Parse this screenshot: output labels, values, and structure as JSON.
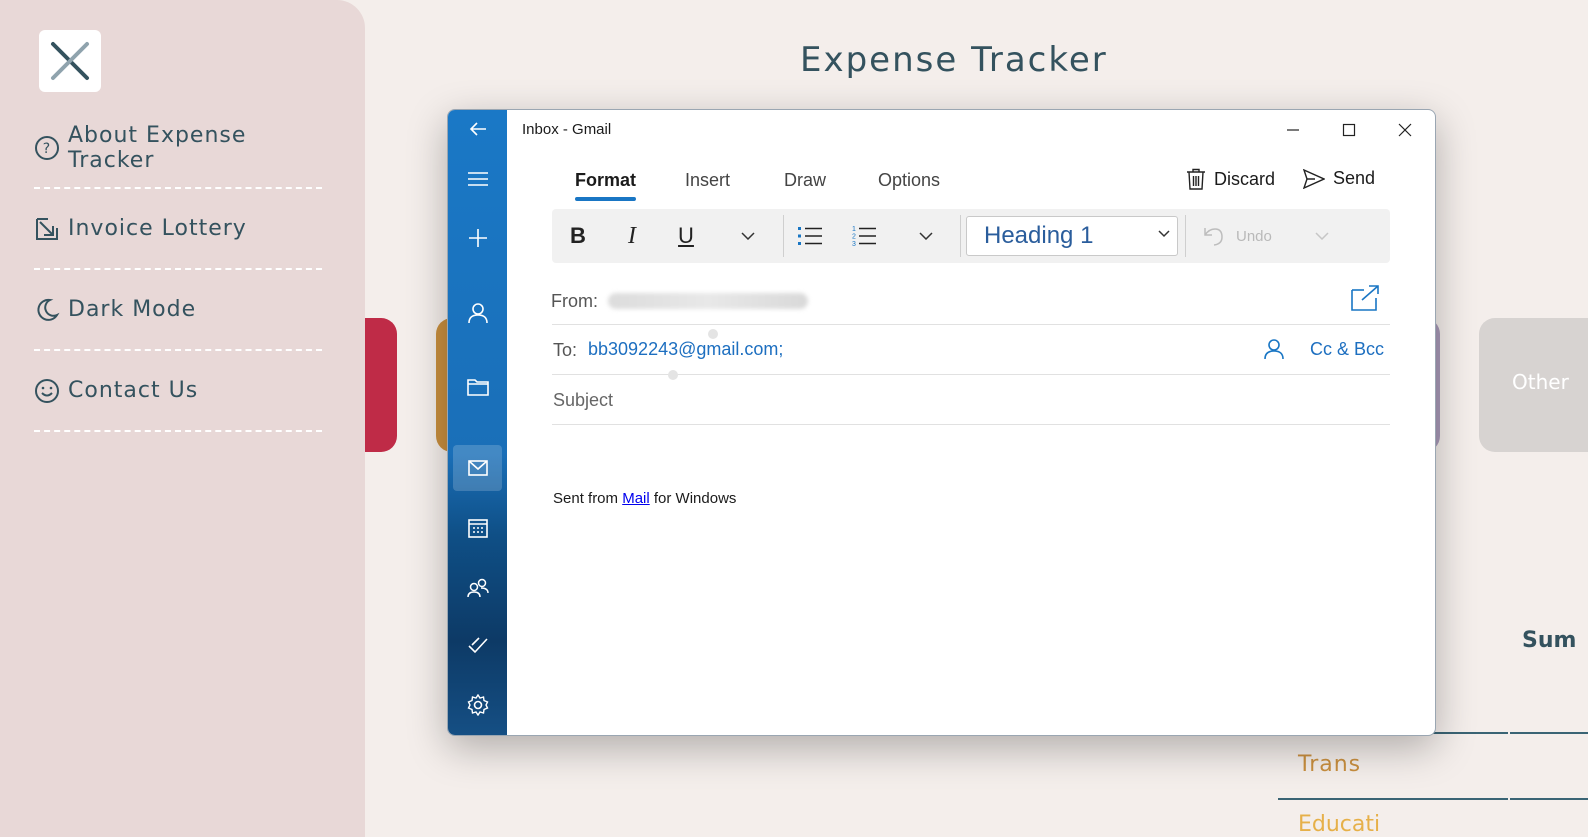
{
  "app": {
    "title": "Expense Tracker",
    "menu": [
      {
        "label": "About Expense Tracker",
        "icon": "question-circle-icon"
      },
      {
        "label": "Invoice Lottery",
        "icon": "external-arrow-icon"
      },
      {
        "label": "Dark Mode",
        "icon": "moon-icon"
      },
      {
        "label": "Contact Us",
        "icon": "smiley-icon"
      }
    ],
    "cards": {
      "other_label": "Other"
    },
    "summary_label": "Sum",
    "categories": [
      "Trans",
      "Educati"
    ],
    "colors": {
      "sidebar": "#e8d8d7",
      "accent_dark": "#34525e",
      "red": "#bf2b47",
      "orange": "#c98f3f",
      "purple": "#a99ab8"
    }
  },
  "mail": {
    "window_title": "Inbox - Gmail",
    "tabs": [
      "Format",
      "Insert",
      "Draw",
      "Options"
    ],
    "active_tab": "Format",
    "commands": {
      "discard": "Discard",
      "send": "Send"
    },
    "toolbar": {
      "style": "Heading 1",
      "undo": "Undo"
    },
    "from_label": "From:",
    "to_label": "To:",
    "to_value": "bb3092243@gmail.com;",
    "cc_bcc": "Cc & Bcc",
    "subject_placeholder": "Subject",
    "signature": {
      "prefix": "Sent from ",
      "link": "Mail",
      "suffix": " for Windows"
    },
    "colors": {
      "rail": "#1a78c6",
      "accent": "#1976c4"
    }
  }
}
